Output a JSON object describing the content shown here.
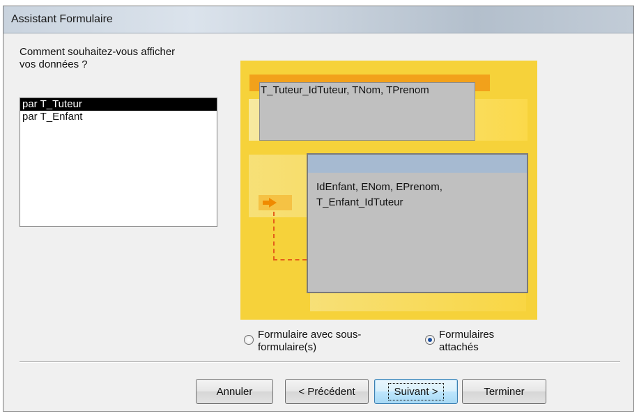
{
  "window": {
    "title": "Assistant Formulaire"
  },
  "question": "Comment souhaitez-vous afficher\nvos données ?",
  "list": {
    "items": [
      "par T_Tuteur",
      "par T_Enfant"
    ],
    "selected_index": 0
  },
  "preview": {
    "main_fields": "T_Tuteur_IdTuteur, TNom, TPrenom",
    "sub_fields": "IdEnfant, ENom, EPrenom,\nT_Enfant_IdTuteur"
  },
  "options": {
    "subform_label": "Formulaire avec sous-\nformulaire(s)",
    "linked_label": "Formulaires\nattachés",
    "selected": "linked"
  },
  "buttons": {
    "cancel": "Annuler",
    "previous": "< Précédent",
    "next": "Suivant >",
    "finish": "Terminer"
  },
  "colors": {
    "preview_bg": "#f6d23a",
    "main_bar": "#f2a11b",
    "sub_header": "#a6bad1",
    "selection": "#000000"
  }
}
